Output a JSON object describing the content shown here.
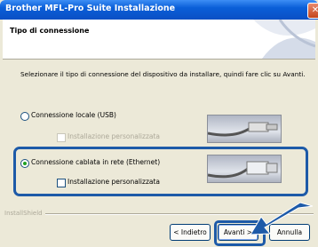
{
  "window": {
    "title": "Brother MFL-Pro Suite Installazione",
    "close_glyph": "✕",
    "colors": {
      "titlebar": "#0a5fd8",
      "highlight": "#1d5aa8"
    }
  },
  "header": {
    "heading": "Tipo di connessione"
  },
  "body": {
    "instruction": "Selezionare il tipo di connessione del dispositivo da installare, quindi fare clic su Avanti.",
    "options": [
      {
        "label": "Connessione locale (USB)",
        "selected": false,
        "custom_label": "Installazione personalizzata",
        "custom_enabled": false,
        "image_icon": "usb-cable-icon"
      },
      {
        "label": "Connessione cablata in rete (Ethernet)",
        "selected": true,
        "custom_label": "Installazione personalizzata",
        "custom_enabled": true,
        "image_icon": "ethernet-cable-icon"
      }
    ]
  },
  "footer": {
    "installshield": "InstallShield",
    "buttons": {
      "back": "< Indietro",
      "next": "Avanti >",
      "cancel": "Annulla"
    }
  }
}
